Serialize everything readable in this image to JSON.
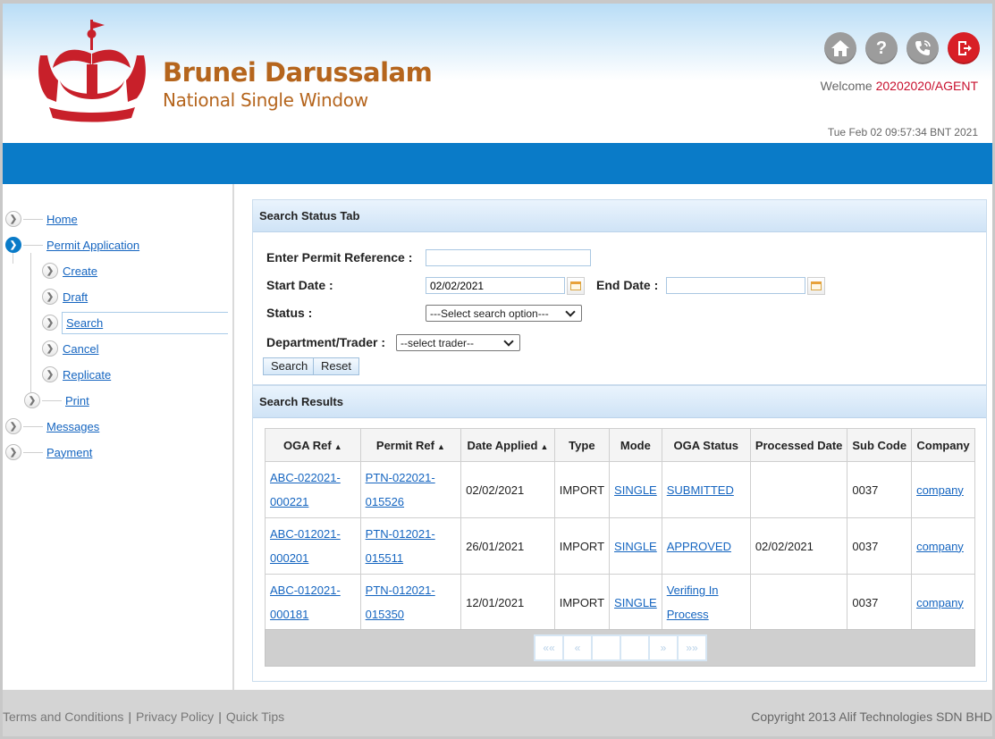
{
  "header": {
    "brand_title": "Brunei Darussalam",
    "brand_subtitle": "National Single Window",
    "welcome_prefix": "Welcome ",
    "user": "20202020/AGENT",
    "datetime": "Tue Feb 02 09:57:34 BNT 2021",
    "icons": [
      "home-icon",
      "help-icon",
      "contact-icon",
      "logout-icon"
    ],
    "colors": {
      "accent_blue": "#0a7bc8",
      "brand_gold": "#b5651d",
      "user_red": "#c8102e",
      "logout_red": "#d81f26"
    }
  },
  "sidebar": {
    "home": "Home",
    "permit_application": "Permit Application",
    "create": "Create",
    "draft": "Draft",
    "search": "Search",
    "cancel": "Cancel",
    "replicate": "Replicate",
    "print": "Print",
    "messages": "Messages",
    "payment": "Payment"
  },
  "search_panel": {
    "title": "Search Status Tab",
    "permit_ref_label": "Enter Permit Reference :",
    "permit_ref_value": "",
    "start_date_label": "Start Date :",
    "start_date_value": "02/02/2021",
    "end_date_label": "End Date :",
    "end_date_value": "",
    "status_label": "Status :",
    "status_selected": "---Select search option---",
    "dept_label": "Department/Trader :",
    "dept_selected": "--select trader--",
    "search_button": "Search",
    "reset_button": "Reset"
  },
  "results_panel": {
    "title": "Search Results",
    "columns": [
      "OGA Ref",
      "Permit Ref",
      "Date Applied",
      "Type",
      "Mode",
      "OGA Status",
      "Processed Date",
      "Sub Code",
      "Company"
    ],
    "rows": [
      {
        "oga_ref_1": "ABC-022021-",
        "oga_ref_2": "000221",
        "permit_ref_1": "PTN-022021-",
        "permit_ref_2": "015526",
        "date_applied": "02/02/2021",
        "type": "IMPORT",
        "mode": "SINGLE",
        "oga_status_1": "SUBMITTED",
        "oga_status_2": "",
        "processed_date": "",
        "sub_code": "0037",
        "company": "company"
      },
      {
        "oga_ref_1": "ABC-012021-",
        "oga_ref_2": "000201",
        "permit_ref_1": "PTN-012021-",
        "permit_ref_2": "015511",
        "date_applied": "26/01/2021",
        "type": "IMPORT",
        "mode": "SINGLE",
        "oga_status_1": "APPROVED",
        "oga_status_2": "",
        "processed_date": "02/02/2021",
        "sub_code": "0037",
        "company": "company"
      },
      {
        "oga_ref_1": "ABC-012021-",
        "oga_ref_2": "000181",
        "permit_ref_1": "PTN-012021-",
        "permit_ref_2": "015350",
        "date_applied": "12/01/2021",
        "type": "IMPORT",
        "mode": "SINGLE",
        "oga_status_1": "Verifing In",
        "oga_status_2": "Process",
        "processed_date": "",
        "sub_code": "0037",
        "company": "company"
      }
    ],
    "pager": {
      "first": "««",
      "prev": "«",
      "page_a": "",
      "page_b": "",
      "next": "»",
      "last": "»»"
    }
  },
  "footer": {
    "terms": "Terms and Conditions",
    "privacy": "Privacy Policy",
    "quick_tips": "Quick Tips",
    "separator": "|",
    "copyright": "Copyright 2013 Alif Technologies SDN BHD"
  }
}
